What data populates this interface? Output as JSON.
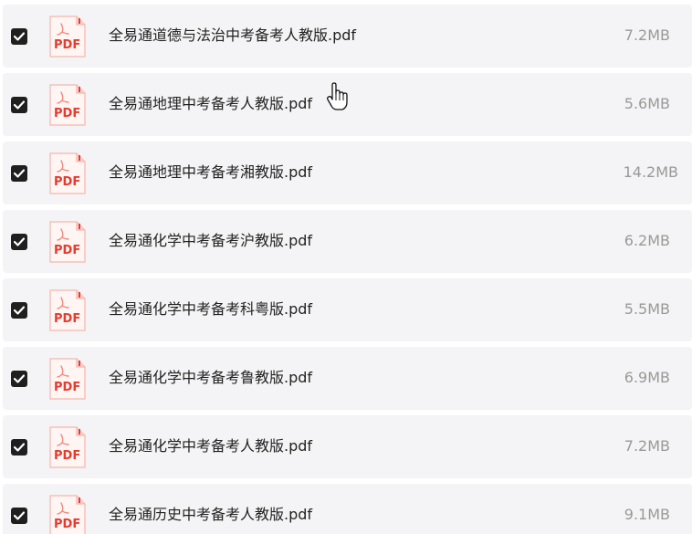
{
  "files": [
    {
      "name": "全易通道德与法治中考备考人教版.pdf",
      "size": "7.2MB",
      "checked": true,
      "icon_label": "PDF"
    },
    {
      "name": "全易通地理中考备考人教版.pdf",
      "size": "5.6MB",
      "checked": true,
      "icon_label": "PDF"
    },
    {
      "name": "全易通地理中考备考湘教版.pdf",
      "size": "14.2MB",
      "checked": true,
      "icon_label": "PDF"
    },
    {
      "name": "全易通化学中考备考沪教版.pdf",
      "size": "6.2MB",
      "checked": true,
      "icon_label": "PDF"
    },
    {
      "name": "全易通化学中考备考科粤版.pdf",
      "size": "5.5MB",
      "checked": true,
      "icon_label": "PDF"
    },
    {
      "name": "全易通化学中考备考鲁教版.pdf",
      "size": "6.9MB",
      "checked": true,
      "icon_label": "PDF"
    },
    {
      "name": "全易通化学中考备考人教版.pdf",
      "size": "7.2MB",
      "checked": true,
      "icon_label": "PDF"
    },
    {
      "name": "全易通历史中考备考人教版.pdf",
      "size": "9.1MB",
      "checked": true,
      "icon_label": "PDF"
    }
  ],
  "colors": {
    "row_background": "#f4f4f6",
    "checkbox": "#1f1f1f",
    "pdf_red": "#e63b2e",
    "size_text": "#999999"
  }
}
